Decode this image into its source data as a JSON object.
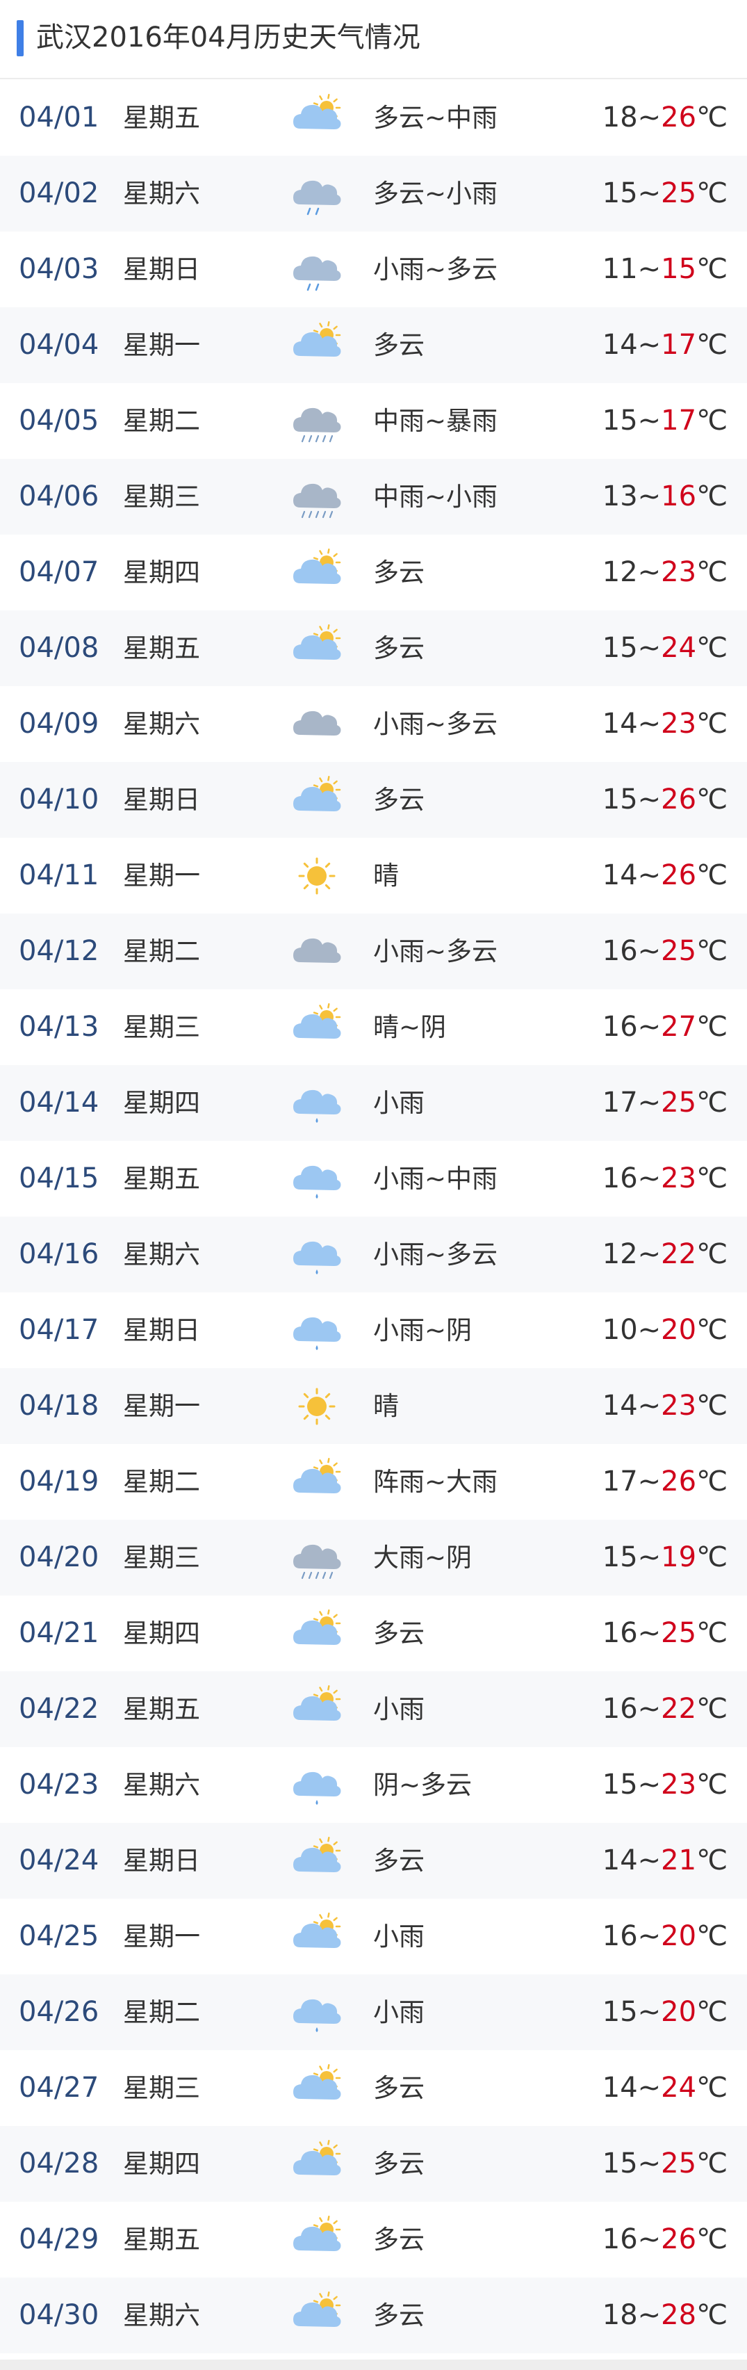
{
  "header": {
    "title": "武汉2016年04月历史天气情况"
  },
  "colors": {
    "accent": "#3f7fe6",
    "high_temp": "#d0021b",
    "date": "#2c4a7a"
  },
  "days": [
    {
      "date": "04/01",
      "weekday": "星期五",
      "icon": "partly-cloudy-icon",
      "weather": "多云~中雨",
      "low": "18",
      "sep": "~",
      "high": "26",
      "unit": "℃"
    },
    {
      "date": "04/02",
      "weekday": "星期六",
      "icon": "cloud-rain-icon",
      "weather": "多云~小雨",
      "low": "15",
      "sep": "~",
      "high": "25",
      "unit": "℃"
    },
    {
      "date": "04/03",
      "weekday": "星期日",
      "icon": "cloud-rain-icon",
      "weather": "小雨~多云",
      "low": "11",
      "sep": "~",
      "high": "15",
      "unit": "℃"
    },
    {
      "date": "04/04",
      "weekday": "星期一",
      "icon": "partly-cloudy-icon",
      "weather": "多云",
      "low": "14",
      "sep": "~",
      "high": "17",
      "unit": "℃"
    },
    {
      "date": "04/05",
      "weekday": "星期二",
      "icon": "heavy-rain-icon",
      "weather": "中雨~暴雨",
      "low": "15",
      "sep": "~",
      "high": "17",
      "unit": "℃"
    },
    {
      "date": "04/06",
      "weekday": "星期三",
      "icon": "heavy-rain-icon",
      "weather": "中雨~小雨",
      "low": "13",
      "sep": "~",
      "high": "16",
      "unit": "℃"
    },
    {
      "date": "04/07",
      "weekday": "星期四",
      "icon": "partly-cloudy-icon",
      "weather": "多云",
      "low": "12",
      "sep": "~",
      "high": "23",
      "unit": "℃"
    },
    {
      "date": "04/08",
      "weekday": "星期五",
      "icon": "partly-cloudy-icon",
      "weather": "多云",
      "low": "15",
      "sep": "~",
      "high": "24",
      "unit": "℃"
    },
    {
      "date": "04/09",
      "weekday": "星期六",
      "icon": "overcast-icon",
      "weather": "小雨~多云",
      "low": "14",
      "sep": "~",
      "high": "23",
      "unit": "℃"
    },
    {
      "date": "04/10",
      "weekday": "星期日",
      "icon": "partly-cloudy-icon",
      "weather": "多云",
      "low": "15",
      "sep": "~",
      "high": "26",
      "unit": "℃"
    },
    {
      "date": "04/11",
      "weekday": "星期一",
      "icon": "sun-icon",
      "weather": "晴",
      "low": "14",
      "sep": "~",
      "high": "26",
      "unit": "℃"
    },
    {
      "date": "04/12",
      "weekday": "星期二",
      "icon": "overcast-icon",
      "weather": "小雨~多云",
      "low": "16",
      "sep": "~",
      "high": "25",
      "unit": "℃"
    },
    {
      "date": "04/13",
      "weekday": "星期三",
      "icon": "partly-cloudy-icon",
      "weather": "晴~阴",
      "low": "16",
      "sep": "~",
      "high": "27",
      "unit": "℃"
    },
    {
      "date": "04/14",
      "weekday": "星期四",
      "icon": "light-rain-icon",
      "weather": "小雨",
      "low": "17",
      "sep": "~",
      "high": "25",
      "unit": "℃"
    },
    {
      "date": "04/15",
      "weekday": "星期五",
      "icon": "light-rain-icon",
      "weather": "小雨~中雨",
      "low": "16",
      "sep": "~",
      "high": "23",
      "unit": "℃"
    },
    {
      "date": "04/16",
      "weekday": "星期六",
      "icon": "light-rain-icon",
      "weather": "小雨~多云",
      "low": "12",
      "sep": "~",
      "high": "22",
      "unit": "℃"
    },
    {
      "date": "04/17",
      "weekday": "星期日",
      "icon": "light-rain-icon",
      "weather": "小雨~阴",
      "low": "10",
      "sep": "~",
      "high": "20",
      "unit": "℃"
    },
    {
      "date": "04/18",
      "weekday": "星期一",
      "icon": "sun-icon",
      "weather": "晴",
      "low": "14",
      "sep": "~",
      "high": "23",
      "unit": "℃"
    },
    {
      "date": "04/19",
      "weekday": "星期二",
      "icon": "partly-cloudy-icon",
      "weather": "阵雨~大雨",
      "low": "17",
      "sep": "~",
      "high": "26",
      "unit": "℃"
    },
    {
      "date": "04/20",
      "weekday": "星期三",
      "icon": "heavy-rain-icon",
      "weather": "大雨~阴",
      "low": "15",
      "sep": "~",
      "high": "19",
      "unit": "℃"
    },
    {
      "date": "04/21",
      "weekday": "星期四",
      "icon": "partly-cloudy-icon",
      "weather": "多云",
      "low": "16",
      "sep": "~",
      "high": "25",
      "unit": "℃"
    },
    {
      "date": "04/22",
      "weekday": "星期五",
      "icon": "partly-cloudy-icon",
      "weather": "小雨",
      "low": "16",
      "sep": "~",
      "high": "22",
      "unit": "℃"
    },
    {
      "date": "04/23",
      "weekday": "星期六",
      "icon": "light-rain-icon",
      "weather": "阴~多云",
      "low": "15",
      "sep": "~",
      "high": "23",
      "unit": "℃"
    },
    {
      "date": "04/24",
      "weekday": "星期日",
      "icon": "partly-cloudy-icon",
      "weather": "多云",
      "low": "14",
      "sep": "~",
      "high": "21",
      "unit": "℃"
    },
    {
      "date": "04/25",
      "weekday": "星期一",
      "icon": "partly-cloudy-icon",
      "weather": "小雨",
      "low": "16",
      "sep": "~",
      "high": "20",
      "unit": "℃"
    },
    {
      "date": "04/26",
      "weekday": "星期二",
      "icon": "light-rain-icon",
      "weather": "小雨",
      "low": "15",
      "sep": "~",
      "high": "20",
      "unit": "℃"
    },
    {
      "date": "04/27",
      "weekday": "星期三",
      "icon": "partly-cloudy-icon",
      "weather": "多云",
      "low": "14",
      "sep": "~",
      "high": "24",
      "unit": "℃"
    },
    {
      "date": "04/28",
      "weekday": "星期四",
      "icon": "partly-cloudy-icon",
      "weather": "多云",
      "low": "15",
      "sep": "~",
      "high": "25",
      "unit": "℃"
    },
    {
      "date": "04/29",
      "weekday": "星期五",
      "icon": "partly-cloudy-icon",
      "weather": "多云",
      "low": "16",
      "sep": "~",
      "high": "26",
      "unit": "℃"
    },
    {
      "date": "04/30",
      "weekday": "星期六",
      "icon": "partly-cloudy-icon",
      "weather": "多云",
      "low": "18",
      "sep": "~",
      "high": "28",
      "unit": "℃"
    }
  ]
}
